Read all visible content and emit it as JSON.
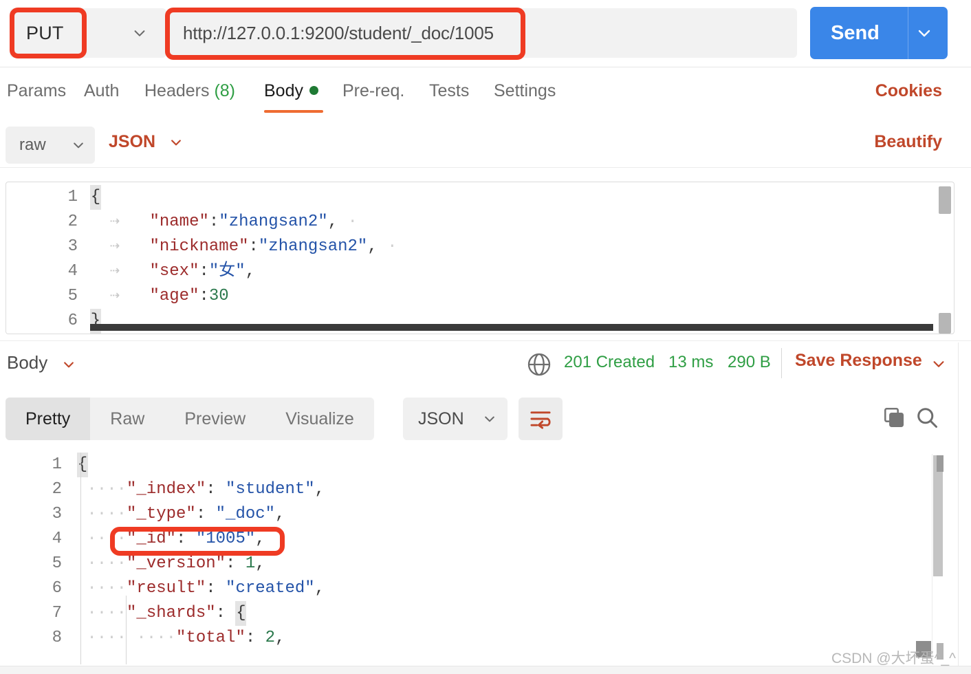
{
  "request": {
    "method": "PUT",
    "url": "http://127.0.0.1:9200/student/_doc/1005",
    "send_label": "Send",
    "tabs": [
      {
        "label": "Params",
        "active": false
      },
      {
        "label": "Auth",
        "active": false
      },
      {
        "label": "Headers",
        "count": "(8)",
        "active": false
      },
      {
        "label": "Body",
        "active": true,
        "dot": true
      },
      {
        "label": "Pre-req.",
        "active": false
      },
      {
        "label": "Tests",
        "active": false
      },
      {
        "label": "Settings",
        "active": false
      }
    ],
    "cookies_label": "Cookies",
    "body_mode": "raw",
    "body_format": "JSON",
    "beautify_label": "Beautify",
    "editor": {
      "line_numbers": [
        "1",
        "2",
        "3",
        "4",
        "5",
        "6"
      ],
      "lines": [
        "{",
        "    \"name\":\"zhangsan2\",",
        "    \"nickname\":\"zhangsan2\",",
        "    \"sex\":\"女\",",
        "    \"age\":30",
        "}"
      ]
    }
  },
  "response": {
    "body_label": "Body",
    "status_code": "201 Created",
    "time": "13 ms",
    "size": "290 B",
    "save_response_label": "Save Response",
    "tabs": [
      {
        "label": "Pretty",
        "active": true
      },
      {
        "label": "Raw",
        "active": false
      },
      {
        "label": "Preview",
        "active": false
      },
      {
        "label": "Visualize",
        "active": false
      }
    ],
    "format": "JSON",
    "editor": {
      "line_numbers": [
        "1",
        "2",
        "3",
        "4",
        "5",
        "6",
        "7",
        "8"
      ],
      "lines": [
        "{",
        "    \"_index\": \"student\",",
        "    \"_type\": \"_doc\",",
        "    \"_id\": \"1005\",",
        "    \"_version\": 1,",
        "    \"result\": \"created\",",
        "    \"_shards\": {",
        "        \"total\": 2,"
      ]
    }
  },
  "watermark": "CSDN @大坏蛋^_^",
  "colors": {
    "accent_orange": "#c0472a",
    "send_blue": "#3a86e8",
    "status_green": "#2f9e44",
    "annotation_red": "#ef3b23"
  }
}
